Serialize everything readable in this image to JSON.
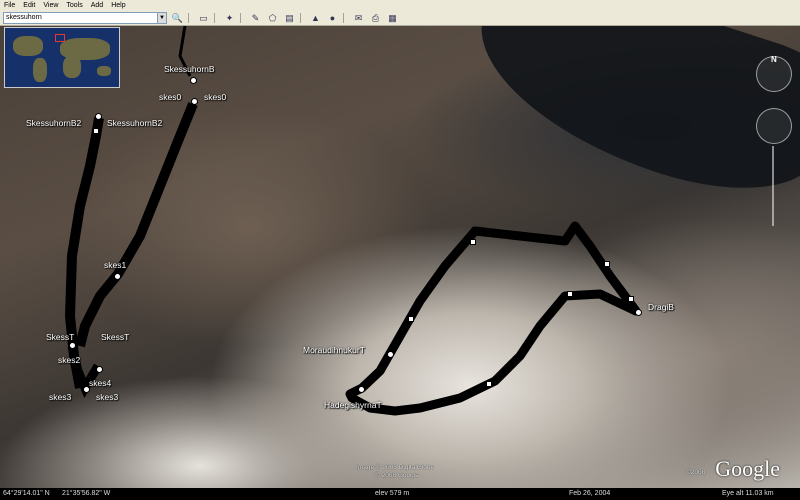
{
  "menu": [
    "File",
    "Edit",
    "View",
    "Tools",
    "Add",
    "Help"
  ],
  "search": {
    "value": "skessuhorn"
  },
  "toolbar_icons": [
    "search-icon",
    "sidebar-icon",
    "placemark-icon",
    "path-icon",
    "polygon-icon",
    "overlay-icon",
    "sky-icon",
    "planet-icon",
    "email-icon",
    "print-icon",
    "maps-icon"
  ],
  "placemarks": {
    "skessuhornB": "SkessuhornB",
    "skes0_a": "skes0",
    "skes0_b": "skes0",
    "skessuhornB2_a": "SkessuhornB2",
    "skessuhornB2_b": "SkessuhornB2",
    "skes1": "skes1",
    "skessT_a": "SkessT",
    "skessT_b": "SkessT",
    "skes2": "skes2",
    "skes4": "skes4",
    "skes3_a": "skes3",
    "skes3_b": "skes3",
    "moraudihnukurT": "MoraudihnukurT",
    "hadegishyrnaT": "HadegishyrnaT",
    "dragiB": "DragiB"
  },
  "compass": {
    "north": "N"
  },
  "logo": "Google",
  "imagery_credit": "Image © 2008 DigitalGlobe",
  "imagery_credit2": "© 2008 Google",
  "copyright_year": "©2008",
  "status": {
    "lat": "64°29'14.01\" N",
    "lon": "21°35'56.82\" W",
    "elev": "elev 579 m",
    "date": "Feb 26, 2004",
    "eye_alt": "Eye alt  11.03 km"
  }
}
